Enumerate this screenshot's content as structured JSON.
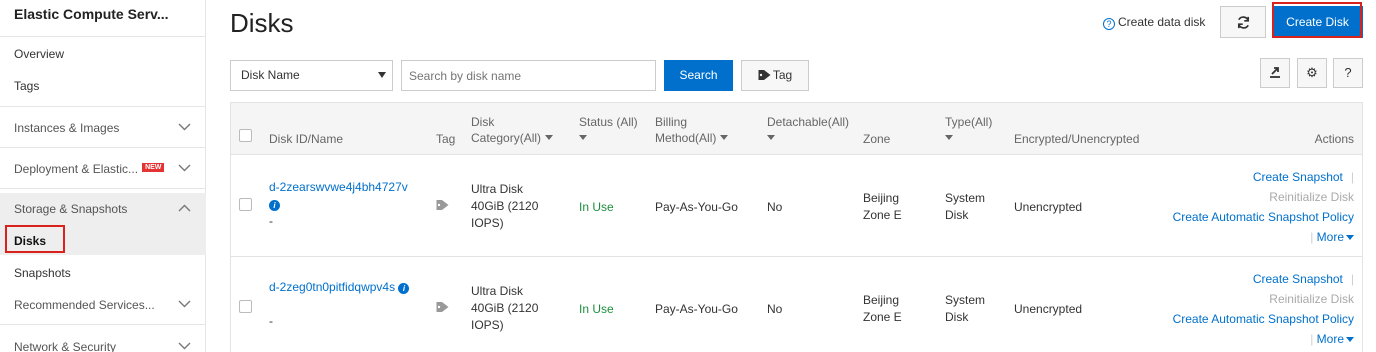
{
  "sidebar": {
    "title": "Elastic Compute Serv...",
    "overview": "Overview",
    "tags": "Tags",
    "instances_images": "Instances & Images",
    "deployment": "Deployment & Elastic...",
    "new_badge": "NEW",
    "storage_snapshots": "Storage & Snapshots",
    "disks": "Disks",
    "snapshots": "Snapshots",
    "recommended": "Recommended Services...",
    "network_security": "Network & Security"
  },
  "header": {
    "title": "Disks",
    "create_data_disk": "Create data disk",
    "create_disk_button": "Create Disk"
  },
  "filters": {
    "field_select": "Disk Name",
    "search_placeholder": "Search by disk name",
    "search_button": "Search",
    "tag_button": "Tag"
  },
  "toolbar": {
    "settings_icon": "gear-icon",
    "help_label": "?"
  },
  "table": {
    "headers": {
      "disk_id": "Disk ID/Name",
      "tag": "Tag",
      "category_1": "Disk",
      "category_2": "Category(All)",
      "status": "Status (All)",
      "billing_1": "Billing",
      "billing_2": "Method(All)",
      "detachable": "Detachable(All)",
      "zone": "Zone",
      "type": "Type(All)",
      "encrypted": "Encrypted/Unencrypted",
      "actions": "Actions"
    },
    "rows": [
      {
        "id": "d-2zearswvwe4j4bh4727v",
        "name": "-",
        "category_1": "Ultra Disk",
        "category_2": "40GiB (2120",
        "category_3": "IOPS)",
        "status": "In Use",
        "billing": "Pay-As-You-Go",
        "detachable": "No",
        "zone_1": "Beijing",
        "zone_2": "Zone E",
        "type_1": "System",
        "type_2": "Disk",
        "encrypted": "Unencrypted",
        "action_snapshot": "Create Snapshot",
        "action_reinit": "Reinitialize Disk",
        "action_auto_policy": "Create Automatic Snapshot Policy",
        "action_more": "More"
      },
      {
        "id": "d-2zeg0tn0pitfidqwpv4s",
        "name": "-",
        "category_1": "Ultra Disk",
        "category_2": "40GiB (2120",
        "category_3": "IOPS)",
        "status": "In Use",
        "billing": "Pay-As-You-Go",
        "detachable": "No",
        "zone_1": "Beijing",
        "zone_2": "Zone E",
        "type_1": "System",
        "type_2": "Disk",
        "encrypted": "Unencrypted",
        "action_snapshot": "Create Snapshot",
        "action_reinit": "Reinitialize Disk",
        "action_auto_policy": "Create Automatic Snapshot Policy",
        "action_more": "More"
      }
    ]
  },
  "colors": {
    "primary": "#0070cc",
    "highlight_border": "#d9221c",
    "status_green": "#1e8e3e",
    "new_badge": "#e53333"
  }
}
